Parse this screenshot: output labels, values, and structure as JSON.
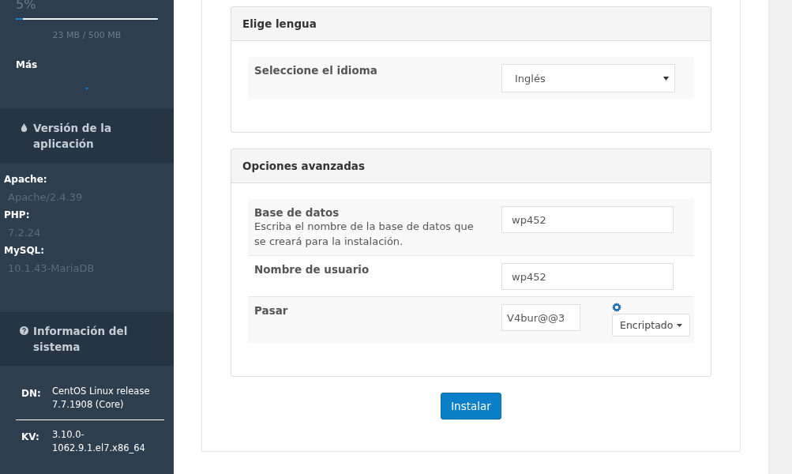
{
  "sidebar": {
    "disk": {
      "percent": "5%",
      "level": 0.05,
      "usage": "23 MB / 500 MB"
    },
    "more_label": "Más",
    "sections": [
      {
        "kind": "versions",
        "title": "Versión de la aplicación",
        "items": [
          {
            "label": "Apache:",
            "value": "Apache/2.4.39"
          },
          {
            "label": "PHP:",
            "value": "7.2.24"
          },
          {
            "label": "MySQL:",
            "value": "10.1.43-MariaDB"
          }
        ]
      },
      {
        "kind": "system",
        "title": "Información del sistema",
        "items": [
          {
            "label": "DN:",
            "value": "CentOS Linux release 7.7.1908 (Core)"
          },
          {
            "label": "KV:",
            "value": "3.10.0-1062.9.1.el7.x86_64"
          }
        ]
      }
    ]
  },
  "panels": [
    {
      "title": "Elige lengua",
      "rows": [
        {
          "kind": "select",
          "label": "Seleccione el idioma",
          "value": "Inglés"
        }
      ]
    },
    {
      "title": "Opciones avanzadas",
      "rows": [
        {
          "kind": "text",
          "label": "Base de datos",
          "help": "Escriba el nombre de la base de datos que se creará para la instalación.",
          "value": "wp452"
        },
        {
          "kind": "text",
          "label": "Nombre de usuario",
          "value": "wp452"
        },
        {
          "kind": "password",
          "label": "Pasar",
          "value": "V4bur@@3",
          "mode": "Encriptado"
        }
      ]
    }
  ],
  "install_button": "Instalar"
}
